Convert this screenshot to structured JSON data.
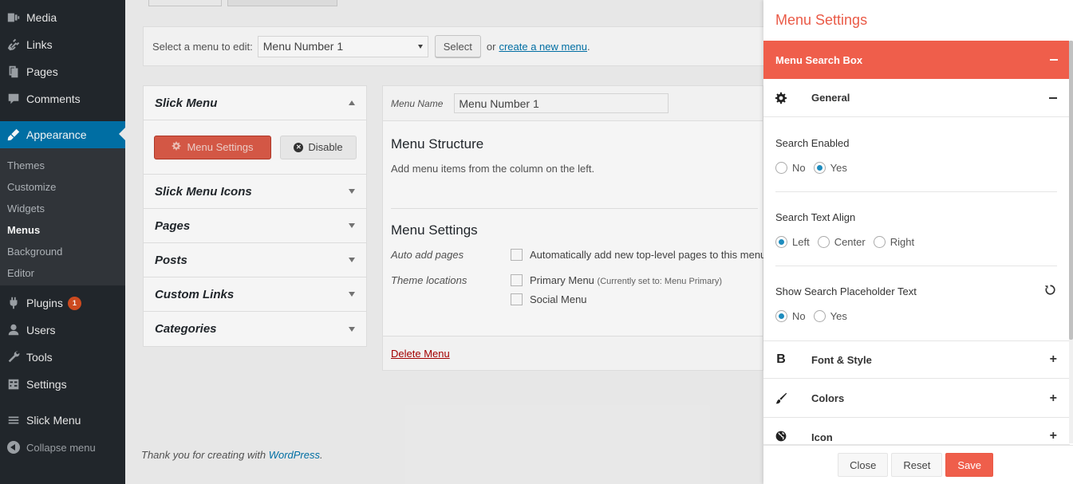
{
  "sidebar": {
    "items": [
      {
        "label": "Media",
        "icon": "media-icon"
      },
      {
        "label": "Links",
        "icon": "links-icon"
      },
      {
        "label": "Pages",
        "icon": "pages-icon"
      },
      {
        "label": "Comments",
        "icon": "comments-icon"
      },
      {
        "label": "Appearance",
        "icon": "appearance-icon"
      },
      {
        "label": "Plugins",
        "icon": "plugins-icon",
        "badge": "1"
      },
      {
        "label": "Users",
        "icon": "users-icon"
      },
      {
        "label": "Tools",
        "icon": "tools-icon"
      },
      {
        "label": "Settings",
        "icon": "settings-icon"
      },
      {
        "label": "Slick Menu",
        "icon": "slick-menu-icon"
      }
    ],
    "submenu": [
      "Themes",
      "Customize",
      "Widgets",
      "Menus",
      "Background",
      "Editor"
    ],
    "collapse_label": "Collapse menu"
  },
  "manage": {
    "select_label": "Select a menu to edit:",
    "selected_menu": "Menu Number 1",
    "select_button": "Select",
    "or_text": "or",
    "create_link": "create a new menu",
    "period": "."
  },
  "accordion": {
    "slick_menu": "Slick Menu",
    "menu_settings_button": "Menu Settings",
    "disable_button": "Disable",
    "sections": [
      "Slick Menu Icons",
      "Pages",
      "Posts",
      "Custom Links",
      "Categories"
    ]
  },
  "editor": {
    "menu_name_label": "Menu Name",
    "menu_name_value": "Menu Number 1",
    "structure_title": "Menu Structure",
    "structure_hint": "Add menu items from the column on the left.",
    "settings_title": "Menu Settings",
    "auto_add_label": "Auto add pages",
    "auto_add_text": "Automatically add new top-level pages to this menu",
    "theme_locations_label": "Theme locations",
    "primary_menu": "Primary Menu",
    "primary_note": "(Currently set to: Menu Primary)",
    "social_menu": "Social Menu",
    "delete_link": "Delete Menu"
  },
  "footer": {
    "thanks_prefix": "Thank you for creating with",
    "wordpress": "WordPress",
    "period": "."
  },
  "panel": {
    "title": "Menu Settings",
    "band_label": "Menu Search Box",
    "general_label": "General",
    "search_enabled_label": "Search Enabled",
    "search_enabled_options": [
      "No",
      "Yes"
    ],
    "search_enabled_value": "Yes",
    "text_align_label": "Search Text Align",
    "text_align_options": [
      "Left",
      "Center",
      "Right"
    ],
    "text_align_value": "Left",
    "placeholder_label": "Show Search Placeholder Text",
    "placeholder_options": [
      "No",
      "Yes"
    ],
    "placeholder_value": "No",
    "sections": [
      {
        "label": "Font & Style",
        "icon": "bold-icon",
        "glyph": "B"
      },
      {
        "label": "Colors",
        "icon": "brush-icon"
      },
      {
        "label": "Icon",
        "icon": "globe-icon"
      }
    ],
    "close_button": "Close",
    "reset_button": "Reset",
    "save_button": "Save",
    "accent_color": "#ef5e4b"
  }
}
